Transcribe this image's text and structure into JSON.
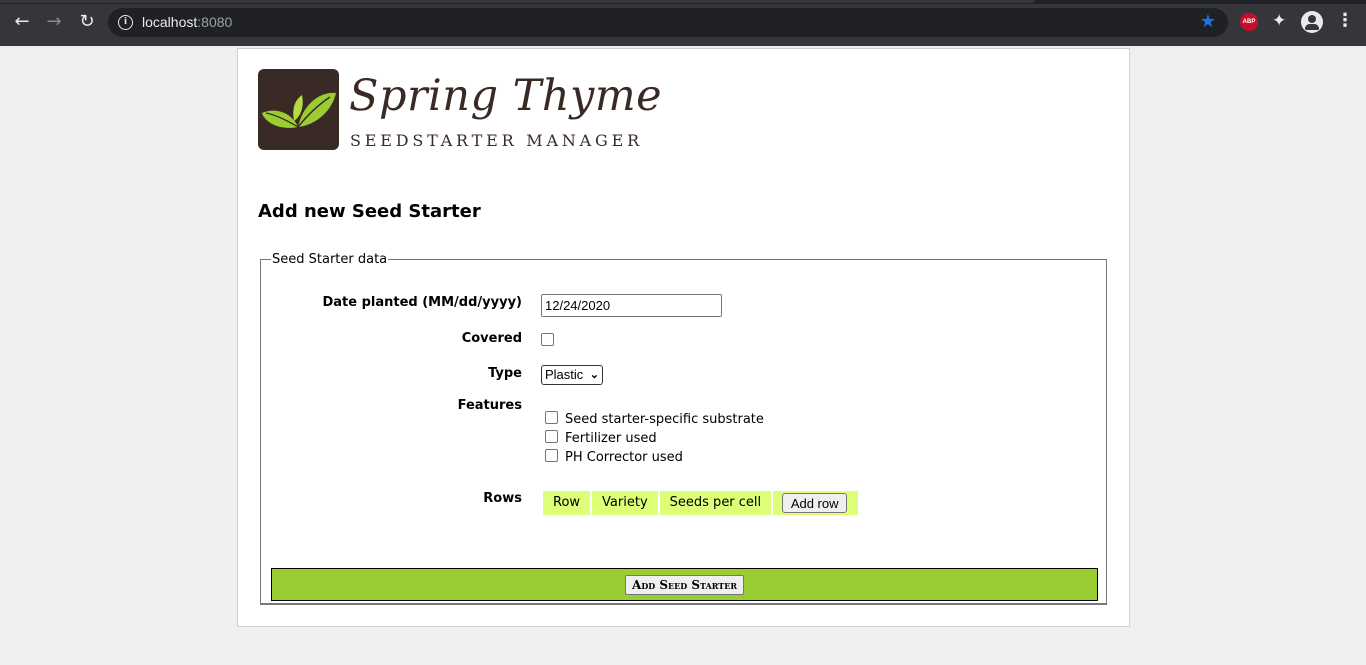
{
  "browser": {
    "url_host": "localhost",
    "url_port": ":8080",
    "ext_abp_label": "ABP"
  },
  "brand": {
    "title": "Spring Thyme",
    "subtitle": "SEEDSTARTER MANAGER"
  },
  "page": {
    "heading": "Add new Seed Starter"
  },
  "form": {
    "legend": "Seed Starter data",
    "date_label": "Date planted (MM/dd/yyyy)",
    "date_value": "12/24/2020",
    "covered_label": "Covered",
    "covered_checked": false,
    "type_label": "Type",
    "type_selected": "Plastic",
    "features_label": "Features",
    "features": [
      {
        "label": "Seed starter-specific substrate",
        "checked": false
      },
      {
        "label": "Fertilizer used",
        "checked": false
      },
      {
        "label": "PH Corrector used",
        "checked": false
      }
    ],
    "rows_label": "Rows",
    "rows_columns": [
      "Row",
      "Variety",
      "Seeds per cell"
    ],
    "add_row_label": "Add row",
    "submit_label": "Add Seed Starter"
  },
  "colors": {
    "header_cell_bg": "#dcff77",
    "submit_bar_bg": "#9acd32",
    "brand_dark": "#3a2a25",
    "leaf_green": "#9acd32"
  }
}
